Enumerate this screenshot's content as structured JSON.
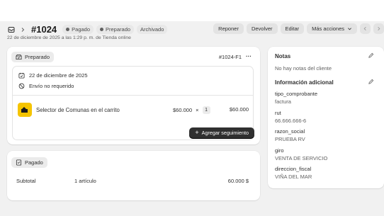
{
  "header": {
    "order_number": "#1024",
    "badges": [
      "Pagado",
      "Preparado",
      "Archivado"
    ],
    "subtitle": "22 de diciembre de 2025 a las 1:29 p. m. de Tienda online",
    "actions": [
      "Reponer",
      "Devolver",
      "Editar",
      "Más acciones"
    ]
  },
  "fulfillment": {
    "status": "Preparado",
    "fulfillment_id": "#1024-F1",
    "more": "···",
    "date": "22 de diciembre de 2025",
    "shipping": "Envío no requerido",
    "item": {
      "name": "Selector de Comunas en el carrito",
      "unit_price": "$60.000",
      "times": "×",
      "quantity": "1",
      "total": "$60.000"
    },
    "tracking_button": "Agregar seguimiento"
  },
  "payment": {
    "status": "Pagado",
    "subtotal_label": "Subtotal",
    "subtotal_items": "1 artículo",
    "subtotal_value": "60.000 $"
  },
  "notes": {
    "title": "Notas",
    "text": "No hay notas del cliente"
  },
  "additional_info": {
    "title": "Información adicional",
    "fields": [
      {
        "label": "tipo_comprobante",
        "value": "factura"
      },
      {
        "label": "rut",
        "value": "66.666.666-6"
      },
      {
        "label": "razon_social",
        "value": "PRUEBA RV"
      },
      {
        "label": "giro",
        "value": "VENTA DE SERVICIO"
      },
      {
        "label": "direccion_fiscal",
        "value": "VIÑA DEL MAR"
      }
    ]
  },
  "colors": {
    "primary_button": "#303030",
    "page_bg": "#f1f1f1",
    "product_thumb": "#f5c400"
  }
}
